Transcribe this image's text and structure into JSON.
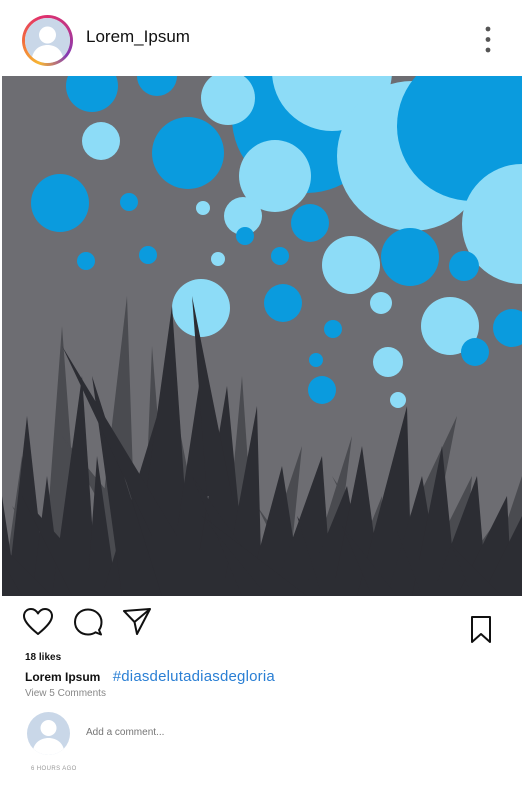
{
  "post": {
    "username": "Lorem_Ipsum",
    "likes": "18 likes",
    "caption_user": "Lorem Ipsum",
    "hashtag": "#diasdelutadiasdegloria",
    "view_comments": "View 5 Comments",
    "comment_placeholder": "Add a comment...",
    "timestamp": "6 HOURS AGO"
  },
  "icons": {
    "more": "vertical-dots-icon",
    "like": "heart-icon",
    "comment": "speech-bubble-icon",
    "share": "paper-plane-icon",
    "save": "bookmark-icon"
  },
  "colors": {
    "sky": "#6d6d72",
    "bubble_dark": "#0a9bde",
    "bubble_light": "#8ddcf7",
    "grass_dark": "#2c2d33",
    "grass_mid": "#4a4b50",
    "hashtag": "#2a7fd4"
  }
}
